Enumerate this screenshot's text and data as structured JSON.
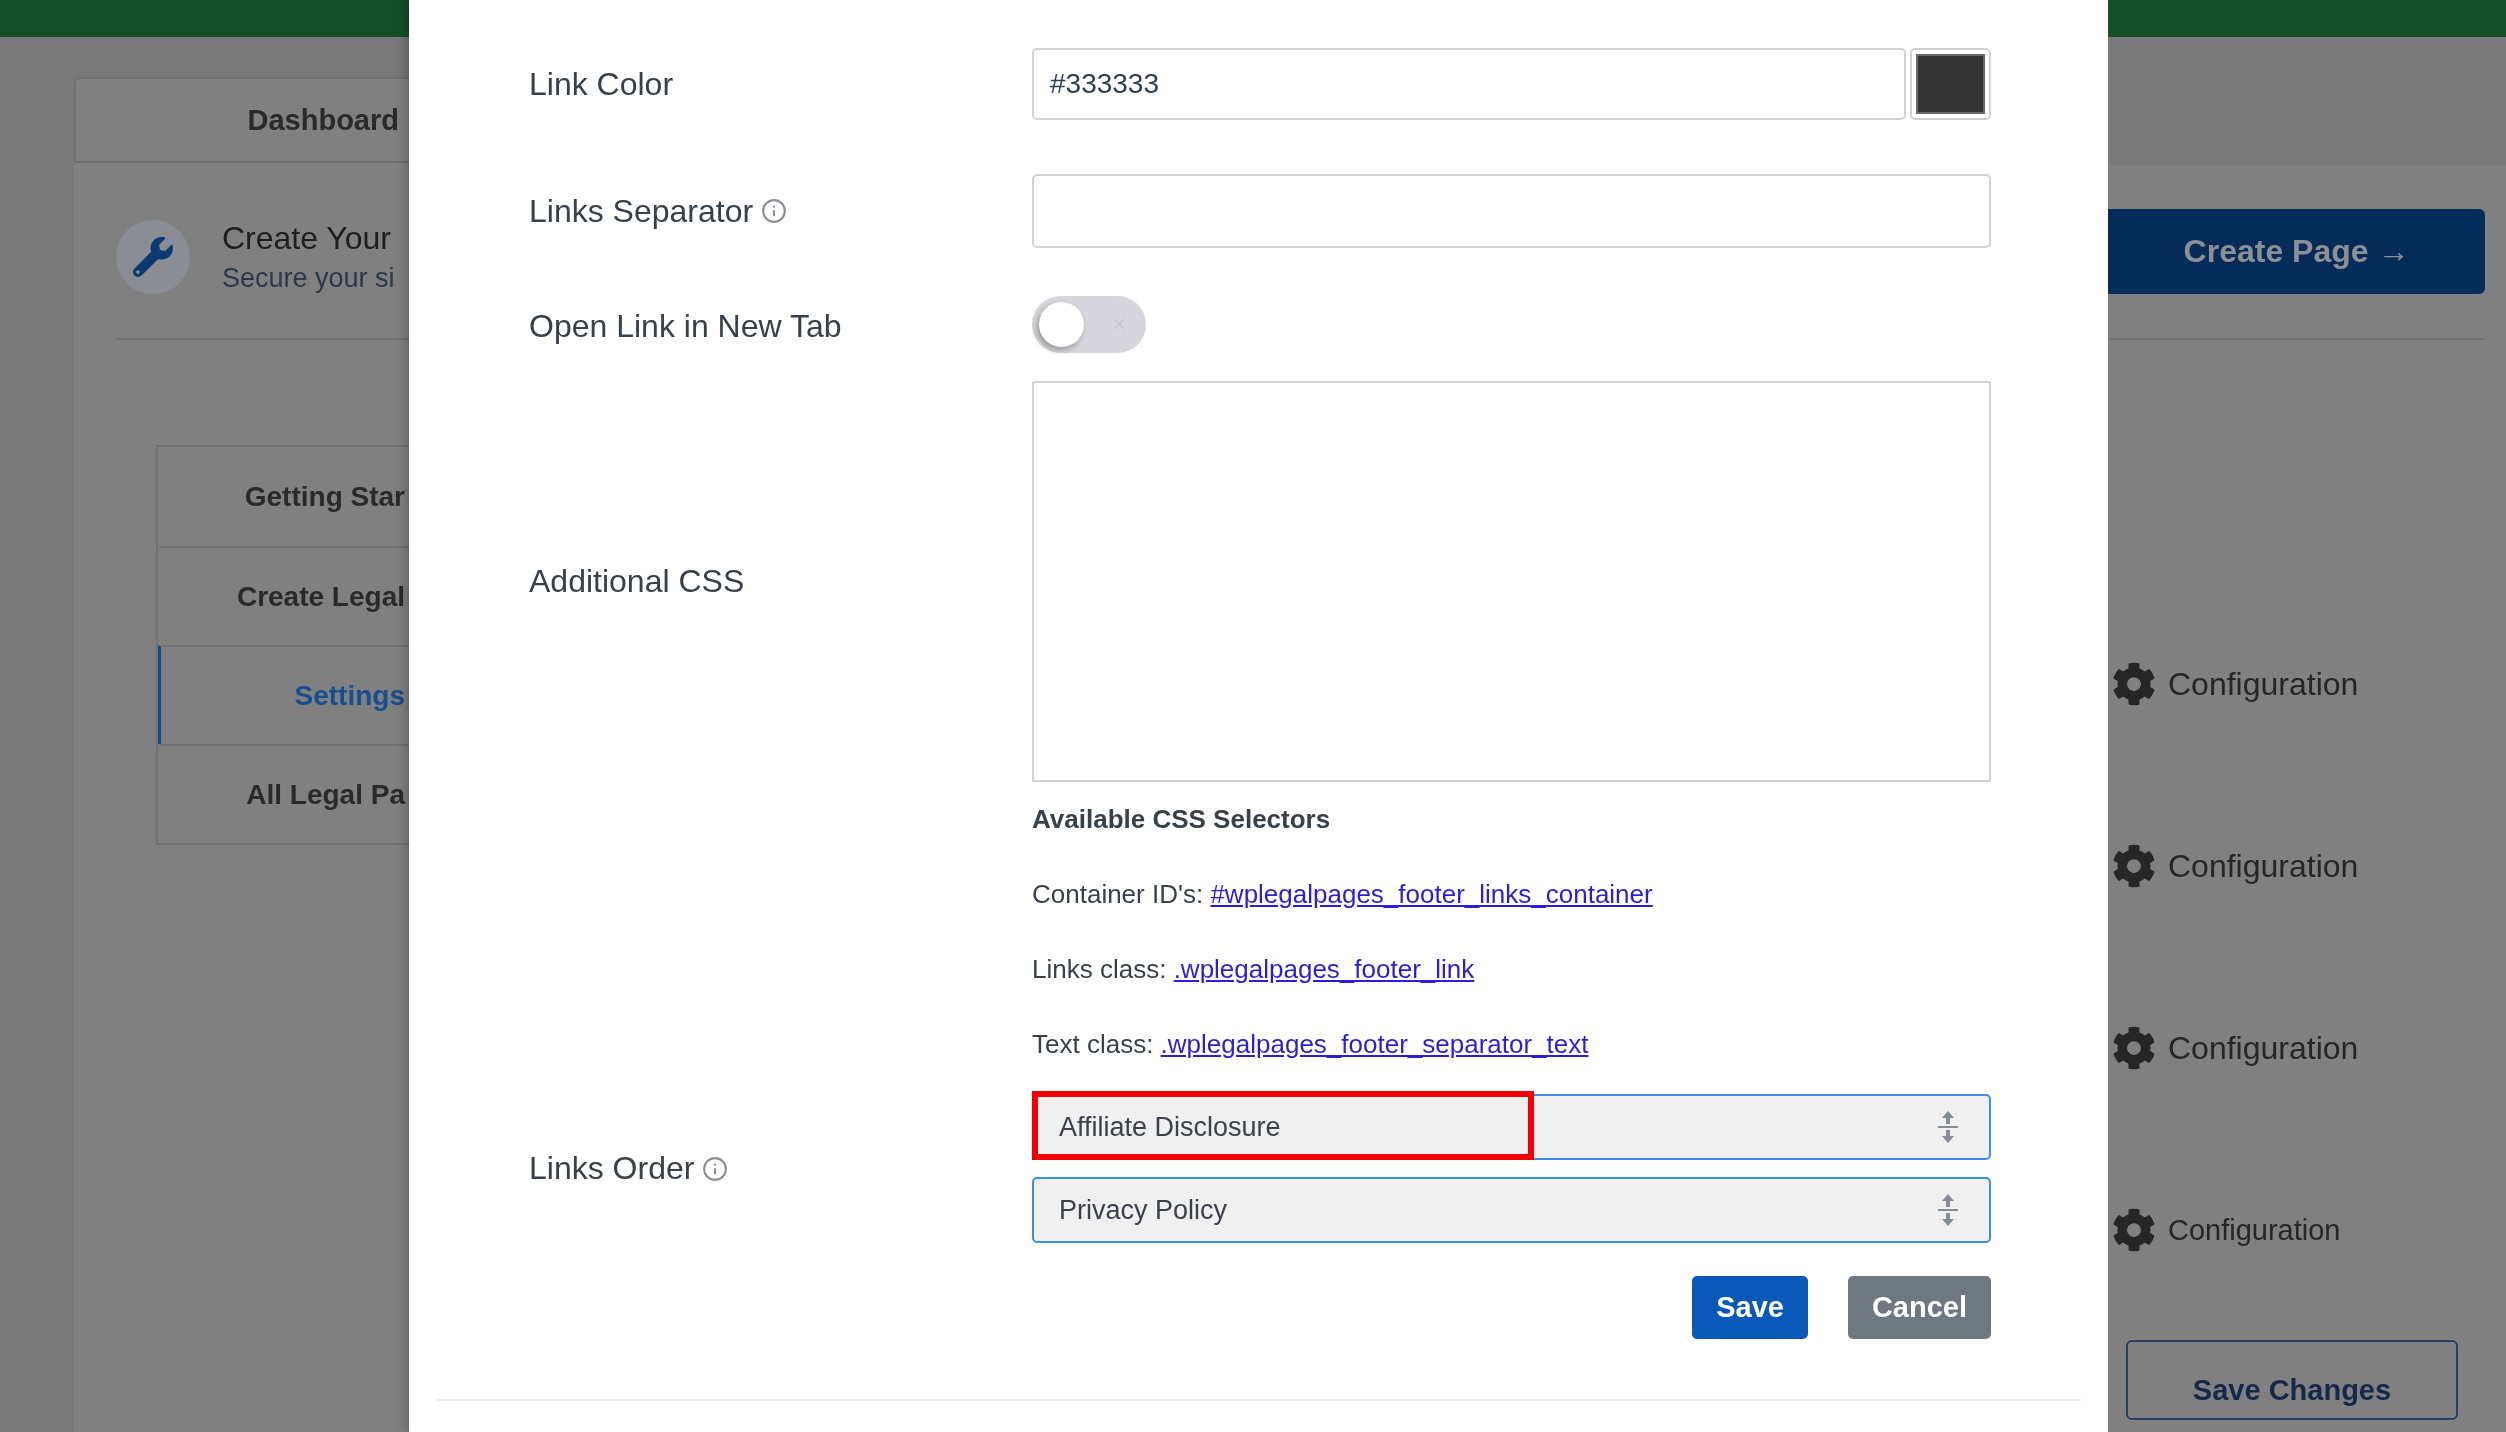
{
  "background": {
    "tabs": [
      {
        "label": "Dashboard"
      }
    ],
    "header": {
      "title": "Create Your",
      "subtitle": "Secure your si"
    },
    "nav": [
      {
        "label": "Getting Star",
        "selected": false
      },
      {
        "label": "Create Legal",
        "selected": false
      },
      {
        "label": "Settings",
        "selected": true
      },
      {
        "label": "All Legal Pa",
        "selected": false
      }
    ],
    "create_button": "Create Page →",
    "config_links": [
      "Configuration",
      "Configuration",
      "Configuration",
      "Configuration"
    ],
    "save_button": "Save Changes"
  },
  "modal": {
    "fields": [
      {
        "kind": "color",
        "label": "Link Color",
        "info": false,
        "value": "#333333",
        "color": "#333333"
      },
      {
        "kind": "text",
        "label": "Links Separator",
        "info": true
      },
      {
        "kind": "toggle",
        "label": "Open Link in New Tab",
        "info": false,
        "on": false
      },
      {
        "kind": "textarea",
        "label": "Additional CSS",
        "info": false
      }
    ],
    "selectors": {
      "title": "Available CSS Selectors",
      "items": [
        {
          "label": "Container ID's:",
          "link": "#wplegalpages_footer_links_container"
        },
        {
          "label": "Links class:",
          "link": ".wplegalpages_footer_link"
        },
        {
          "label": "Text class:",
          "link": ".wplegalpages_footer_separator_text"
        }
      ]
    },
    "links_order": {
      "label": "Links Order",
      "info": true,
      "items": [
        {
          "label": "Affiliate Disclosure",
          "highlighted": true
        },
        {
          "label": "Privacy Policy",
          "highlighted": false
        }
      ]
    },
    "buttons": [
      {
        "label": "Save",
        "kind": "primary"
      },
      {
        "label": "Cancel",
        "kind": "secondary"
      }
    ]
  }
}
